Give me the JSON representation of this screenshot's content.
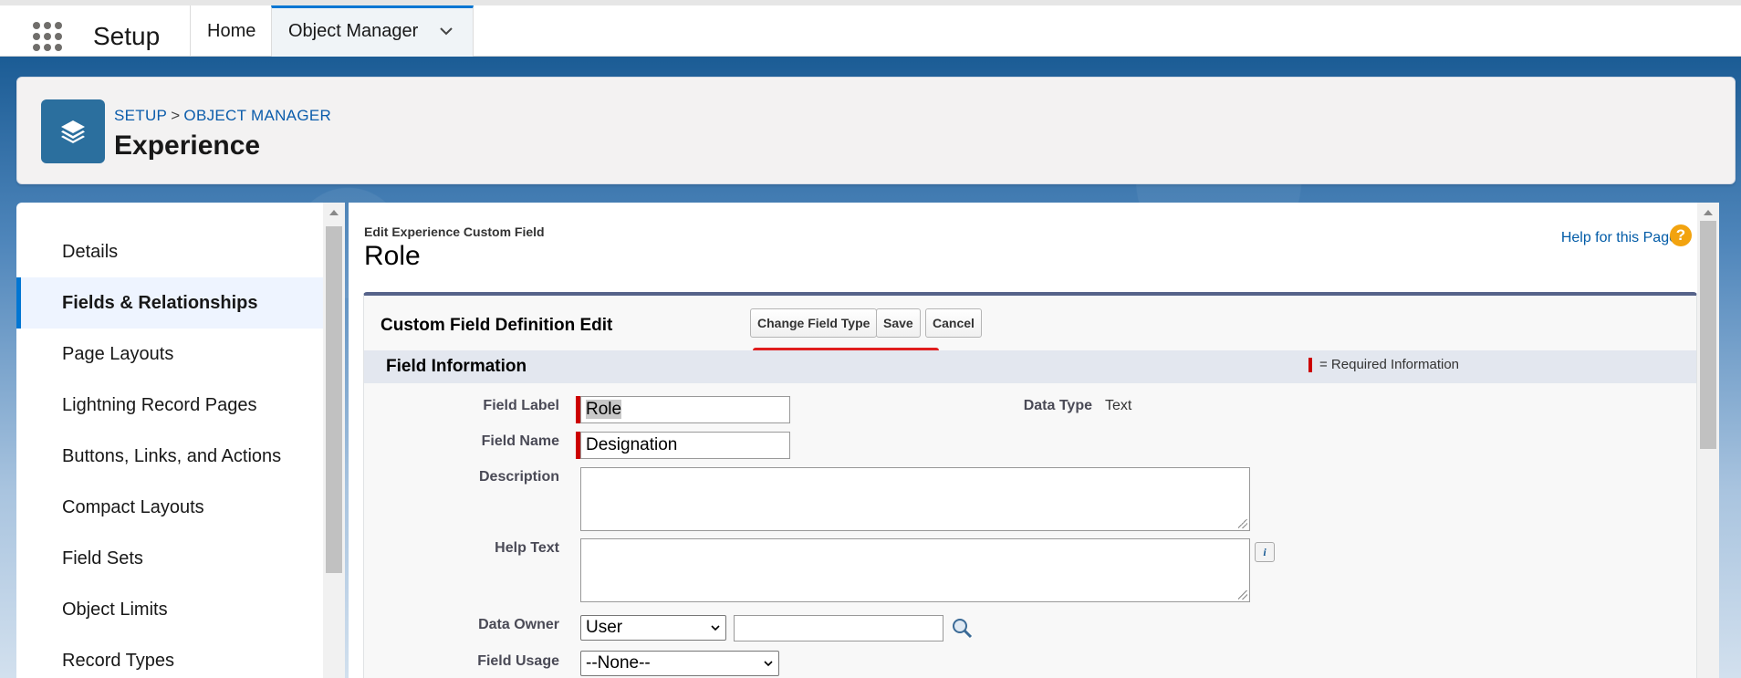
{
  "topnav": {
    "app_name": "Setup",
    "tabs": [
      {
        "label": "Home"
      },
      {
        "label": "Object Manager"
      }
    ]
  },
  "header": {
    "breadcrumb": [
      "SETUP",
      "OBJECT MANAGER"
    ],
    "breadcrumb_sep": ">",
    "title": "Experience"
  },
  "sidebar": {
    "items": [
      {
        "label": "Details"
      },
      {
        "label": "Fields & Relationships",
        "selected": true
      },
      {
        "label": "Page Layouts"
      },
      {
        "label": "Lightning Record Pages"
      },
      {
        "label": "Buttons, Links, and Actions"
      },
      {
        "label": "Compact Layouts"
      },
      {
        "label": "Field Sets"
      },
      {
        "label": "Object Limits"
      },
      {
        "label": "Record Types"
      }
    ]
  },
  "main": {
    "subtitle": "Edit Experience Custom Field",
    "title": "Role",
    "help_link": "Help for this Page",
    "help_icon": "?",
    "form": {
      "title": "Custom Field Definition Edit",
      "buttons": {
        "change_type": "Change Field Type",
        "save": "Save",
        "cancel": "Cancel"
      },
      "section_title": "Field Information",
      "required_legend": "= Required Information",
      "fields": {
        "field_label": {
          "label": "Field Label",
          "value": "Role"
        },
        "field_name": {
          "label": "Field Name",
          "value": "Designation"
        },
        "description": {
          "label": "Description"
        },
        "help_text": {
          "label": "Help Text"
        },
        "data_owner": {
          "label": "Data Owner",
          "selected": "User"
        },
        "field_usage": {
          "label": "Field Usage",
          "selected": "--None--"
        },
        "data_type": {
          "label": "Data Type",
          "value": "Text"
        }
      },
      "info_glyph": "i"
    }
  },
  "colors": {
    "brand_blue": "#0176d3",
    "required_red": "#cc0000",
    "annotation_red": "#e01e1e",
    "object_icon": "#2b6f9e"
  }
}
